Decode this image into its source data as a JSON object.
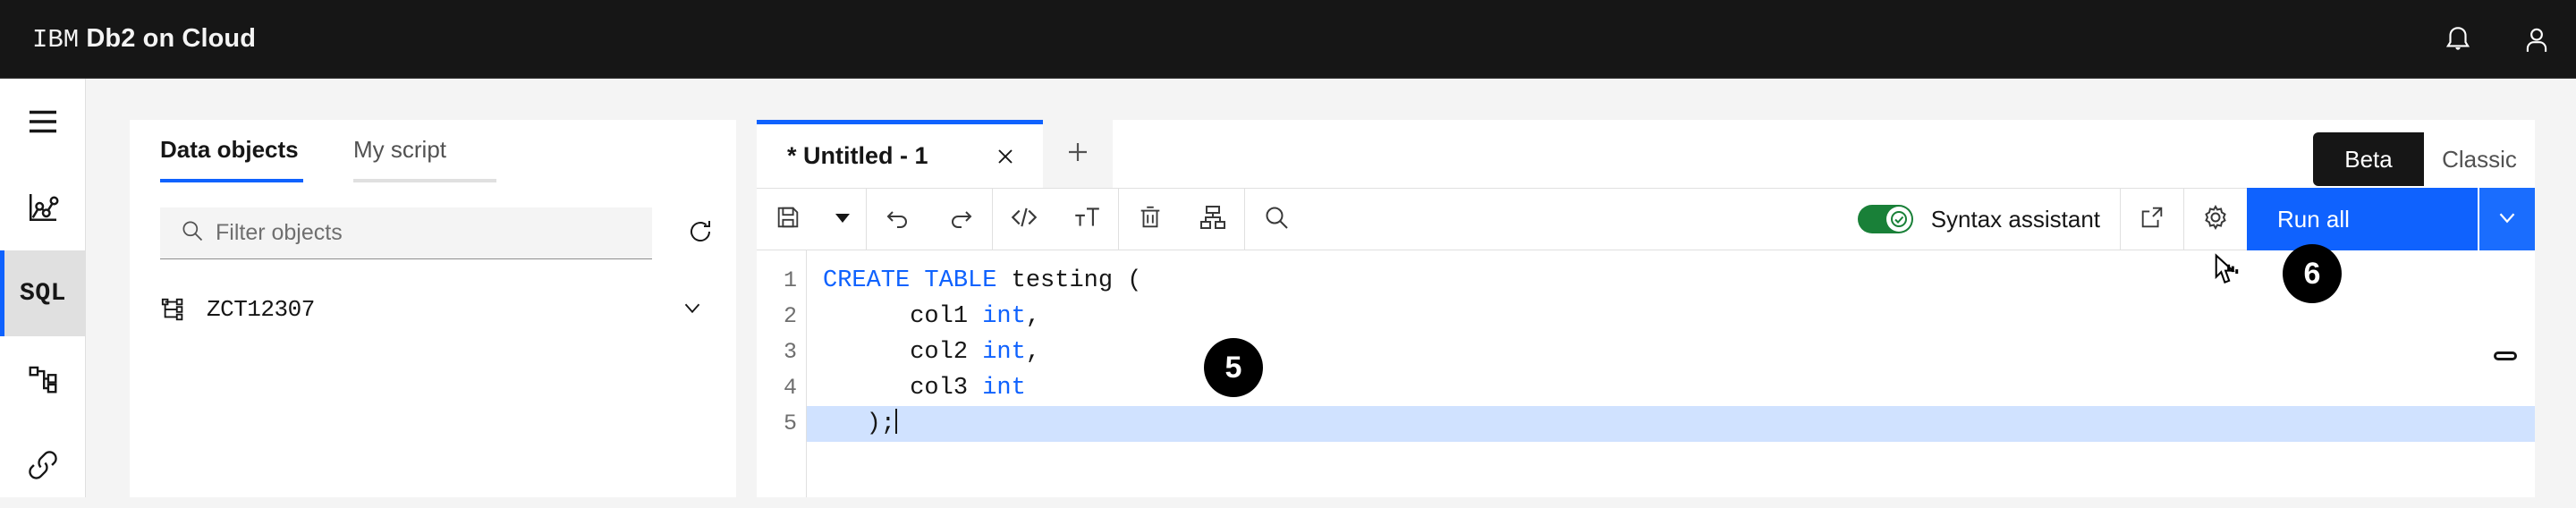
{
  "topnav": {
    "brand_prefix": "IBM",
    "brand_product": "Db2 on Cloud",
    "notifications_title": "Notifications",
    "account_title": "User profile"
  },
  "rail": {
    "items": [
      {
        "name": "menu",
        "label": "Menu",
        "icon": "hamburger-menu-icon",
        "active": false
      },
      {
        "name": "monitor",
        "label": "Monitor",
        "icon": "line-chart-icon",
        "active": false
      },
      {
        "name": "sql",
        "label": "SQL",
        "icon": "sql-text-icon",
        "active": true
      },
      {
        "name": "explore",
        "label": "Explore",
        "icon": "hierarchy-icon",
        "active": false
      },
      {
        "name": "load",
        "label": "Load",
        "icon": "link-icon",
        "active": false
      }
    ]
  },
  "left_panel": {
    "tabs": [
      {
        "label": "Data objects",
        "active": true
      },
      {
        "label": "My script",
        "active": false
      }
    ],
    "filter": {
      "placeholder": "Filter objects",
      "value": "",
      "refresh_label": "Refresh"
    },
    "objects": [
      {
        "name": "ZCT12307",
        "expanded": false
      }
    ]
  },
  "editor": {
    "tabs": [
      {
        "label": "* Untitled - 1",
        "active": true,
        "close_label": "✕"
      }
    ],
    "add_tab_label": "+",
    "toolbar": {
      "save_label": "Save",
      "save_menu_label": "Save options",
      "undo_label": "Undo",
      "redo_label": "Redo",
      "format_code_label": "Format code",
      "text_size_label": "Text size",
      "clear_label": "Clear",
      "visual_explain_label": "Visual explain",
      "find_label": "Find",
      "syntax_assistant_label": "Syntax assistant",
      "syntax_assistant_on": true,
      "open_new_window_label": "Open in new window",
      "settings_label": "Settings",
      "run_all_label": "Run all",
      "run_options_label": "Run options"
    },
    "code": {
      "lines": [
        {
          "num": "1",
          "tokens": [
            {
              "t": "CREATE",
              "k": true
            },
            {
              "t": " "
            },
            {
              "t": "TABLE",
              "k": true
            },
            {
              "t": " testing ("
            }
          ],
          "highlight": false
        },
        {
          "num": "2",
          "tokens": [
            {
              "t": "      col1 "
            },
            {
              "t": "int",
              "k": true
            },
            {
              "t": ","
            }
          ],
          "highlight": false
        },
        {
          "num": "3",
          "tokens": [
            {
              "t": "      col2 "
            },
            {
              "t": "int",
              "k": true
            },
            {
              "t": ","
            }
          ],
          "highlight": false
        },
        {
          "num": "4",
          "tokens": [
            {
              "t": "      col3 "
            },
            {
              "t": "int",
              "k": true
            }
          ],
          "highlight": false
        },
        {
          "num": "5",
          "tokens": [
            {
              "t": "   );"
            }
          ],
          "highlight": true,
          "caret": true
        }
      ]
    }
  },
  "version_switch": {
    "options": [
      {
        "label": "Beta",
        "active": true
      },
      {
        "label": "Classic",
        "active": false
      }
    ]
  },
  "annotations": {
    "badges": [
      {
        "id": "5",
        "label": "5"
      },
      {
        "id": "6",
        "label": "6"
      }
    ]
  },
  "colors": {
    "brand_blue": "#0f62fe",
    "nav_dark": "#161616",
    "toggle_green": "#198038",
    "line_highlight": "#d0e2ff",
    "panel_bg": "#f4f4f4"
  }
}
